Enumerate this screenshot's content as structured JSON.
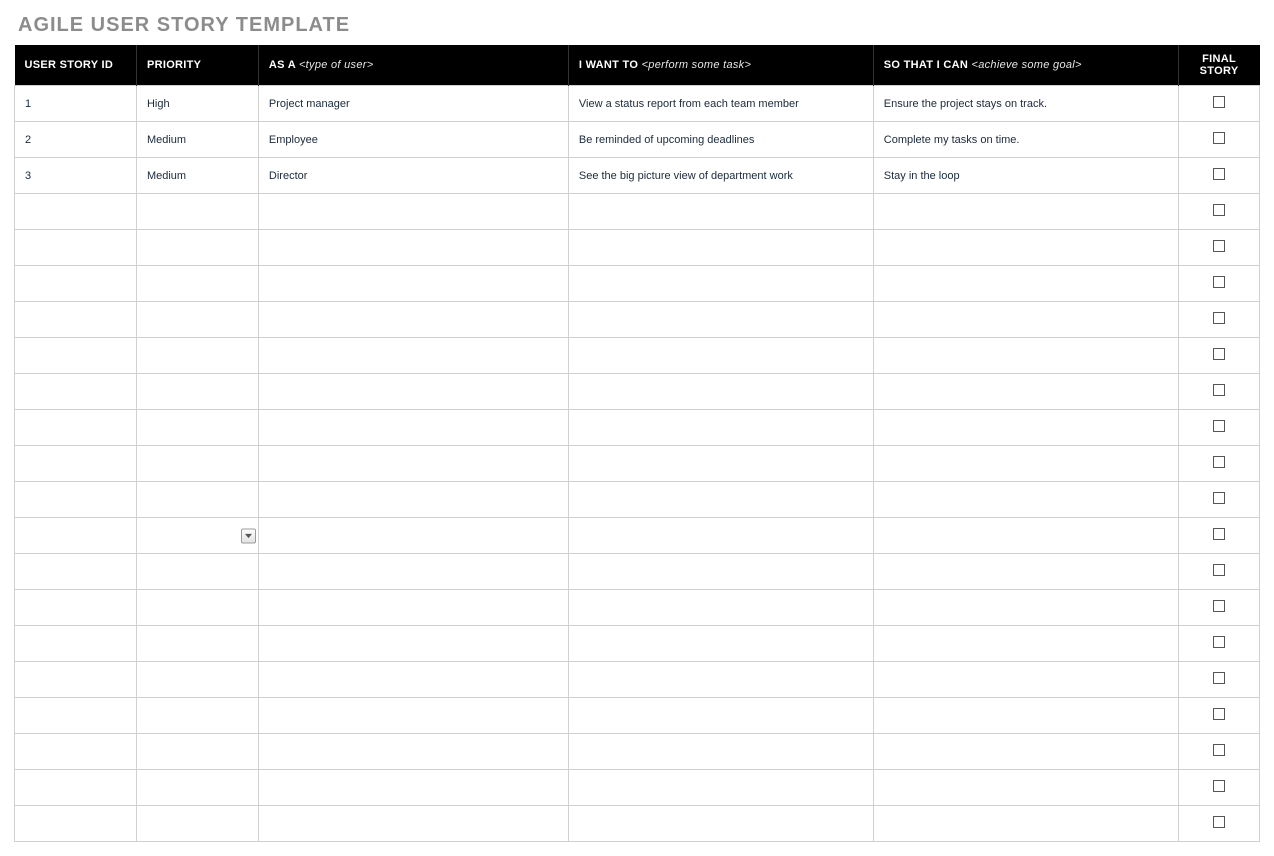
{
  "title": "AGILE USER STORY TEMPLATE",
  "columns": {
    "id": {
      "label": "USER STORY ID",
      "hint": ""
    },
    "prio": {
      "label": "PRIORITY",
      "hint": ""
    },
    "as": {
      "label": "AS A ",
      "hint": "<type of user>"
    },
    "want": {
      "label": "I WANT TO ",
      "hint": "<perform some task>"
    },
    "so": {
      "label": "SO THAT I CAN ",
      "hint": "<achieve some goal>"
    },
    "final": {
      "label": "FINAL STORY",
      "hint": ""
    }
  },
  "rows": [
    {
      "id": "1",
      "priority": "High",
      "as_a": "Project manager",
      "i_want_to": "View a status report from each team member",
      "so_that": "Ensure the project stays on track.",
      "final": false
    },
    {
      "id": "2",
      "priority": "Medium",
      "as_a": "Employee",
      "i_want_to": "Be reminded of upcoming deadlines",
      "so_that": "Complete my tasks on time.",
      "final": false
    },
    {
      "id": "3",
      "priority": "Medium",
      "as_a": "Director",
      "i_want_to": "See the big picture view of department work",
      "so_that": "Stay in the loop",
      "final": false
    },
    {
      "id": "",
      "priority": "",
      "as_a": "",
      "i_want_to": "",
      "so_that": "",
      "final": false
    },
    {
      "id": "",
      "priority": "",
      "as_a": "",
      "i_want_to": "",
      "so_that": "",
      "final": false
    },
    {
      "id": "",
      "priority": "",
      "as_a": "",
      "i_want_to": "",
      "so_that": "",
      "final": false
    },
    {
      "id": "",
      "priority": "",
      "as_a": "",
      "i_want_to": "",
      "so_that": "",
      "final": false
    },
    {
      "id": "",
      "priority": "",
      "as_a": "",
      "i_want_to": "",
      "so_that": "",
      "final": false
    },
    {
      "id": "",
      "priority": "",
      "as_a": "",
      "i_want_to": "",
      "so_that": "",
      "final": false
    },
    {
      "id": "",
      "priority": "",
      "as_a": "",
      "i_want_to": "",
      "so_that": "",
      "final": false
    },
    {
      "id": "",
      "priority": "",
      "as_a": "",
      "i_want_to": "",
      "so_that": "",
      "final": false
    },
    {
      "id": "",
      "priority": "",
      "as_a": "",
      "i_want_to": "",
      "so_that": "",
      "final": false
    },
    {
      "id": "",
      "priority": "",
      "as_a": "",
      "i_want_to": "",
      "so_that": "",
      "final": false,
      "dropdown_on_as": true
    },
    {
      "id": "",
      "priority": "",
      "as_a": "",
      "i_want_to": "",
      "so_that": "",
      "final": false
    },
    {
      "id": "",
      "priority": "",
      "as_a": "",
      "i_want_to": "",
      "so_that": "",
      "final": false
    },
    {
      "id": "",
      "priority": "",
      "as_a": "",
      "i_want_to": "",
      "so_that": "",
      "final": false
    },
    {
      "id": "",
      "priority": "",
      "as_a": "",
      "i_want_to": "",
      "so_that": "",
      "final": false
    },
    {
      "id": "",
      "priority": "",
      "as_a": "",
      "i_want_to": "",
      "so_that": "",
      "final": false
    },
    {
      "id": "",
      "priority": "",
      "as_a": "",
      "i_want_to": "",
      "so_that": "",
      "final": false
    },
    {
      "id": "",
      "priority": "",
      "as_a": "",
      "i_want_to": "",
      "so_that": "",
      "final": false
    },
    {
      "id": "",
      "priority": "",
      "as_a": "",
      "i_want_to": "",
      "so_that": "",
      "final": false
    }
  ]
}
